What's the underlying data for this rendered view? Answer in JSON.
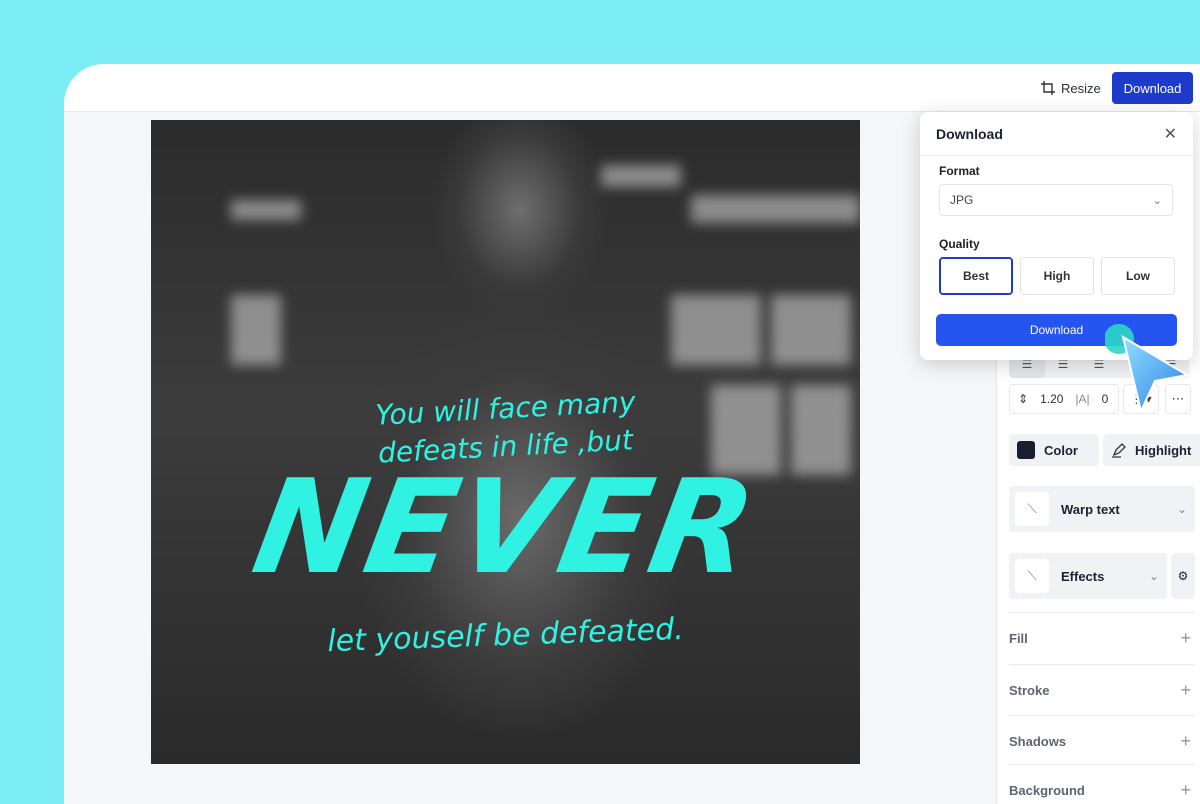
{
  "topbar": {
    "resize_label": "Resize",
    "download_label": "Download"
  },
  "canvas": {
    "quote_line1": "You will face many",
    "quote_line2": "defeats in life ,but",
    "quote_main": "NEVER",
    "quote_line4": "let youself be defeated.",
    "text_color": "#2ff2e2"
  },
  "panel": {
    "line_height": "1.20",
    "letter_spacing": "0",
    "letter_spacing_icon": "|A|",
    "more": "⋯",
    "color_label": "Color",
    "color_swatch": "#1a1d2e",
    "highlight_label": "Highlight",
    "warp_label": "Warp text",
    "effects_label": "Effects",
    "sections": [
      "Fill",
      "Stroke",
      "Shadows",
      "Background"
    ]
  },
  "modal": {
    "title": "Download",
    "format_label": "Format",
    "format_value": "JPG",
    "quality_label": "Quality",
    "quality_options": [
      "Best",
      "High",
      "Low"
    ],
    "selected_quality": "Best",
    "download_label": "Download"
  },
  "colors": {
    "accent": "#1c3bcb",
    "primary_button": "#2654f0",
    "page_bg": "#7cecf5",
    "cursor": "#3aa0f0"
  }
}
